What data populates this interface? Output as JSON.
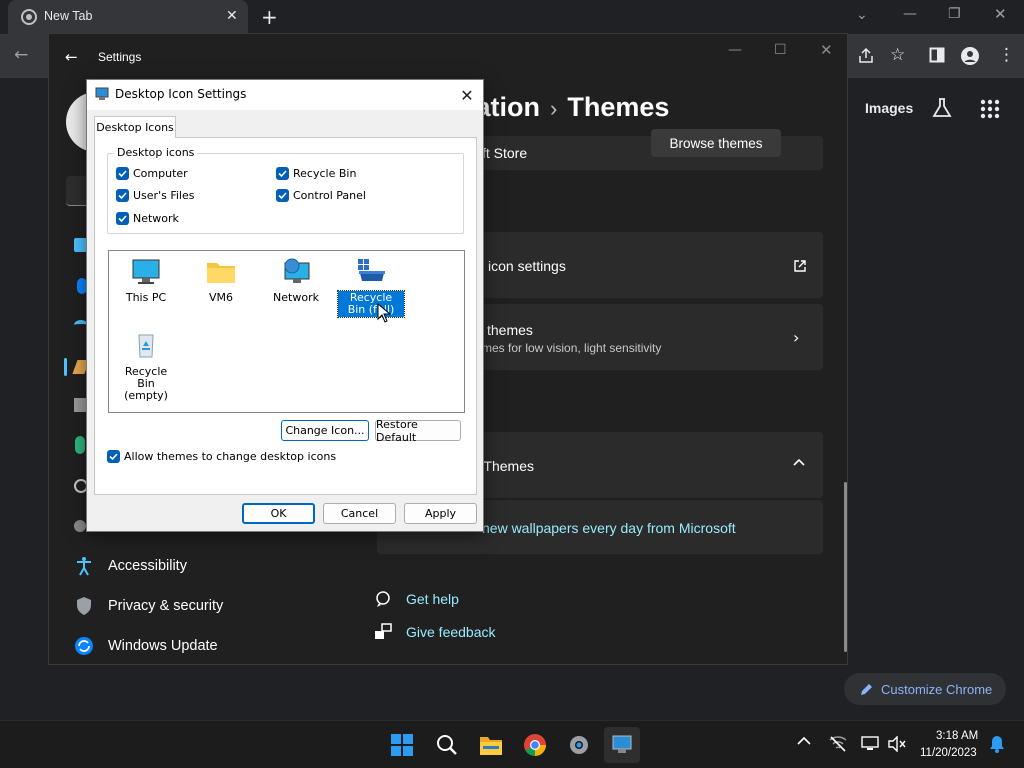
{
  "chrome": {
    "tab_title": "New Tab",
    "images_link": "Images",
    "customize_label": "Customize Chrome"
  },
  "settings": {
    "title": "Settings",
    "header_part1": "zation",
    "header_part2": "Themes",
    "store_text": "ft Store",
    "browse_themes": "Browse themes",
    "icon_settings": "icon settings",
    "contrast_title": "themes",
    "contrast_sub": "mes for low vision, light sensitivity",
    "dynamic_title": "h Themes",
    "dynamic_link": "new wallpapers every day from Microsoft",
    "get_help": "Get help",
    "give_feedback": "Give feedback",
    "nav": [
      {
        "label": "Accessibility"
      },
      {
        "label": "Privacy & security"
      },
      {
        "label": "Windows Update"
      }
    ]
  },
  "dialog": {
    "title": "Desktop Icon Settings",
    "tab": "Desktop Icons",
    "group_label": "Desktop icons",
    "checkboxes": [
      {
        "label": "Computer",
        "checked": true
      },
      {
        "label": "Recycle Bin",
        "checked": true
      },
      {
        "label": "User's Files",
        "checked": true
      },
      {
        "label": "Control Panel",
        "checked": true
      },
      {
        "label": "Network",
        "checked": true
      }
    ],
    "icons": [
      {
        "label": "This PC"
      },
      {
        "label": "VM6"
      },
      {
        "label": "Network"
      },
      {
        "label": "Recycle Bin (full)",
        "selected": true
      },
      {
        "label": "Recycle Bin (empty)"
      }
    ],
    "change_icon": "Change Icon...",
    "restore_default": "Restore Default",
    "allow_themes": "Allow themes to change desktop icons",
    "ok": "OK",
    "cancel": "Cancel",
    "apply": "Apply"
  },
  "taskbar": {
    "time": "3:18 AM",
    "date": "11/20/2023"
  },
  "colors": {
    "accent": "#0078d7",
    "dialog_checkbox": "#005fb8",
    "link": "#99ebff",
    "chrome_link": "#8ab4f8"
  }
}
